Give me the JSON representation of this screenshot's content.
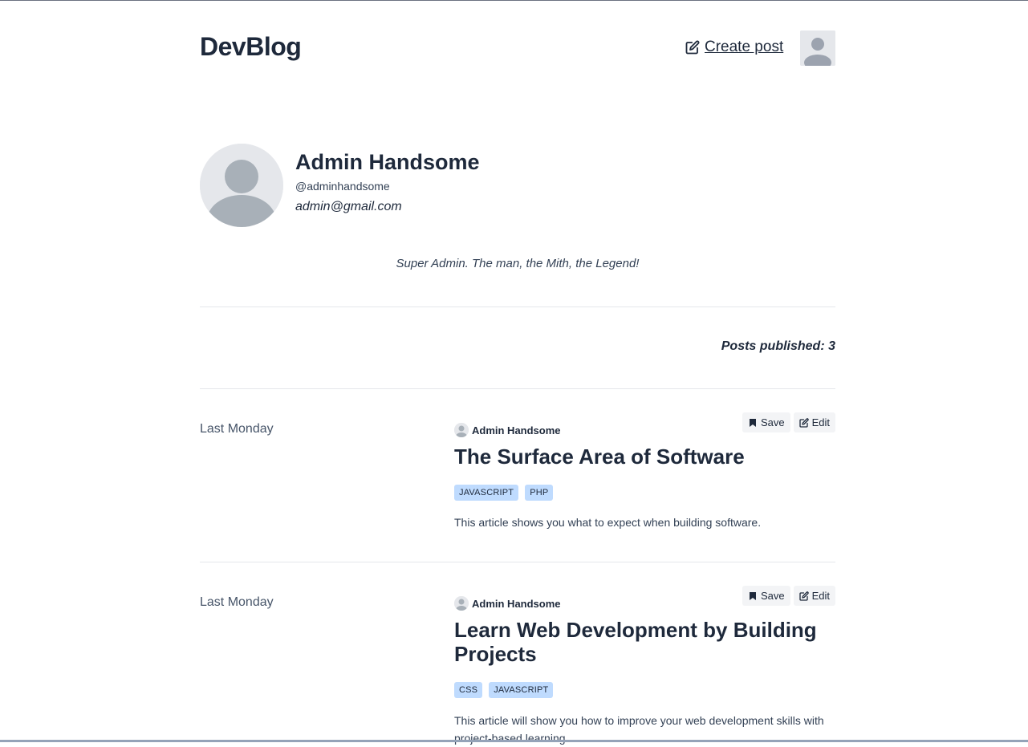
{
  "header": {
    "brand": "DevBlog",
    "create_post_label": "Create post"
  },
  "profile": {
    "name": "Admin Handsome",
    "handle": "@adminhandsome",
    "email": "admin@gmail.com",
    "bio": "Super Admin. The man, the Mith, the Legend!",
    "posts_published_label": "Posts published: 3"
  },
  "posts": [
    {
      "date": "Last Monday",
      "author": "Admin Handsome",
      "save_label": "Save",
      "edit_label": "Edit",
      "title": "The Surface Area of Software",
      "tags": [
        "JAVASCRIPT",
        "PHP"
      ],
      "excerpt": "This article shows you what to expect when building software."
    },
    {
      "date": "Last Monday",
      "author": "Admin Handsome",
      "save_label": "Save",
      "edit_label": "Edit",
      "title": "Learn Web Development by Building Projects",
      "tags": [
        "CSS",
        "JAVASCRIPT"
      ],
      "excerpt": "This article will show you how to improve your web development skills with project-based learning."
    }
  ],
  "icons": {
    "create_post": "edit-icon",
    "save": "bookmark-icon",
    "edit": "edit-icon",
    "avatar": "user-placeholder-icon"
  },
  "colors": {
    "tag_bg": "#bfdbfe",
    "text": "#1e293b",
    "button_bg": "#f3f4f6"
  }
}
